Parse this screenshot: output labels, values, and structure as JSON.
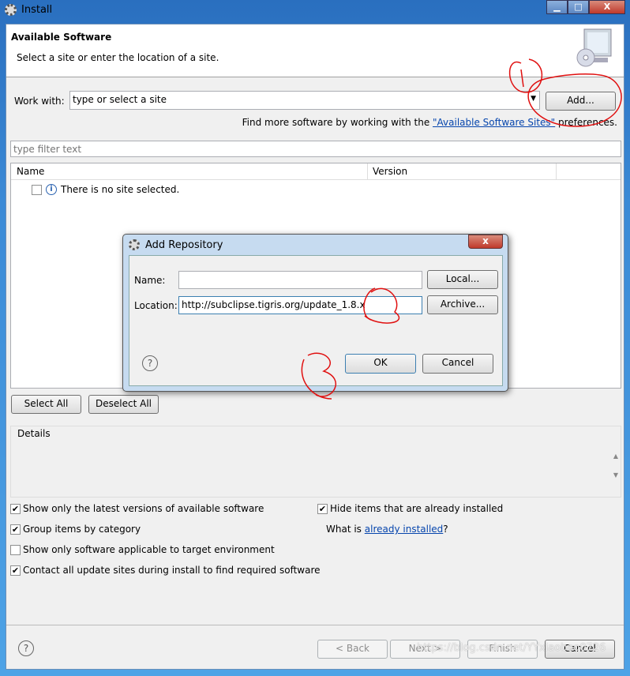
{
  "window": {
    "title": "Install",
    "minimize": "▁",
    "maximize": "□",
    "close": "X"
  },
  "header": {
    "title": "Available Software",
    "description": "Select a site or enter the location of a site."
  },
  "work_with": {
    "label": "Work with:",
    "value": "type or select a site",
    "add_button": "Add..."
  },
  "more_software": {
    "prefix": "Find more software by working with the ",
    "link": "\"Available Software Sites\"",
    "suffix": " preferences."
  },
  "filter": {
    "placeholder": "type filter text"
  },
  "table": {
    "columns": [
      "Name",
      "Version"
    ],
    "rows": [
      {
        "name": "There is no site selected.",
        "checked": false
      }
    ]
  },
  "buttons": {
    "select_all": "Select All",
    "deselect_all": "Deselect All"
  },
  "details": {
    "label": "Details"
  },
  "options": [
    {
      "label": "Show only the latest versions of available software",
      "checked": true
    },
    {
      "label": "Group items by category",
      "checked": true
    },
    {
      "label": "Show only software applicable to target environment",
      "checked": false
    },
    {
      "label": "Contact all update sites during install to find required software",
      "checked": true
    },
    {
      "label": "Hide items that are already installed",
      "checked": true
    }
  ],
  "installed": {
    "prefix": "What is ",
    "link": "already installed",
    "suffix": "?"
  },
  "footer": {
    "back": "< Back",
    "next": "Next >",
    "finish": "Finish",
    "cancel": "Cancel",
    "help": "?"
  },
  "dialog": {
    "title": "Add Repository",
    "name_label": "Name:",
    "name_value": "",
    "location_label": "Location:",
    "location_value": "http://subclipse.tigris.org/update_1.8.x",
    "local": "Local...",
    "archive": "Archive...",
    "ok": "OK",
    "cancel": "Cancel",
    "help": "?",
    "close": "x"
  },
  "annotations": [
    "1",
    "2",
    "3"
  ],
  "watermark": "https://blog.csdn.net/YYxiaobao0726"
}
